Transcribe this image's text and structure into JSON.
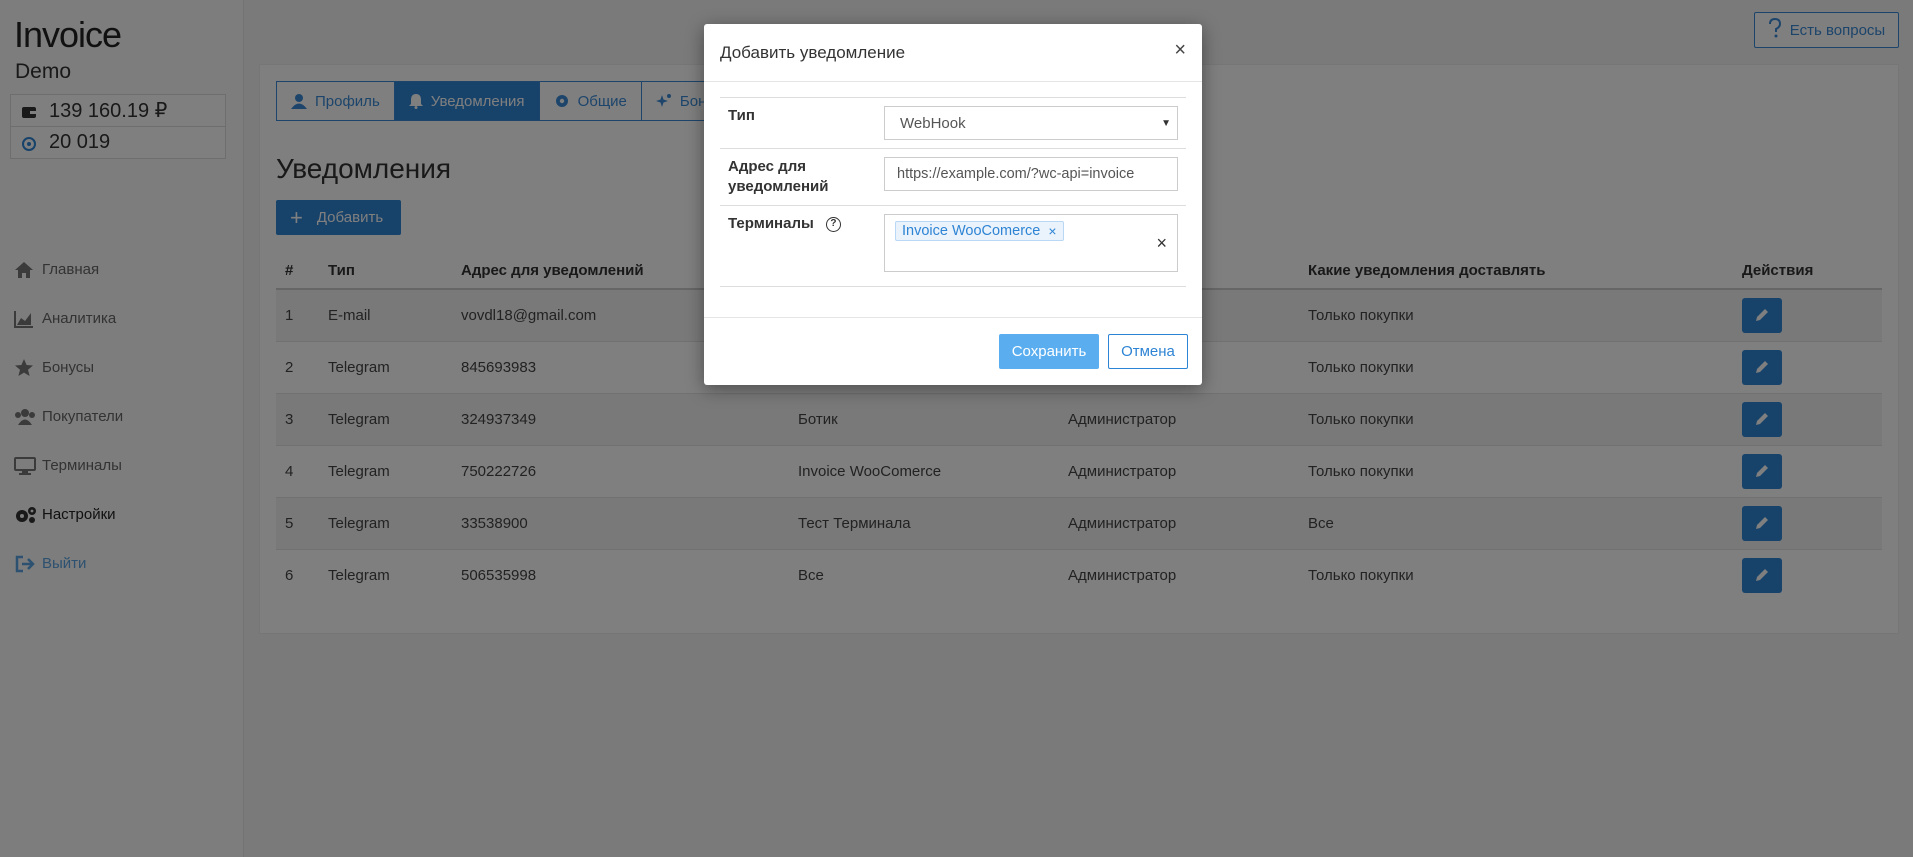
{
  "sidebar": {
    "brand": "Invoice",
    "subbrand": "Demo",
    "balance": "139 160.19 ₽",
    "bonus_balance": "20 019",
    "items": [
      {
        "label": "Главная",
        "icon": "home-icon"
      },
      {
        "label": "Аналитика",
        "icon": "chart-icon"
      },
      {
        "label": "Бонусы",
        "icon": "star-icon"
      },
      {
        "label": "Покупатели",
        "icon": "users-icon"
      },
      {
        "label": "Терминалы",
        "icon": "monitor-icon"
      },
      {
        "label": "Настройки",
        "icon": "gears-icon"
      },
      {
        "label": "Выйти",
        "icon": "logout-icon"
      }
    ]
  },
  "header": {
    "help_label": "Есть вопросы"
  },
  "tabs": [
    {
      "label": "Профиль",
      "icon": "user-icon"
    },
    {
      "label": "Уведомления",
      "icon": "bell-icon"
    },
    {
      "label": "Общие",
      "icon": "gear-icon"
    },
    {
      "label": "Бону",
      "icon": "sparkle-icon"
    }
  ],
  "main": {
    "title": "Уведомления",
    "add_label": "Добавить"
  },
  "table": {
    "headers": [
      "#",
      "Тип",
      "Адрес для уведомлений",
      "",
      "",
      "Какие уведомления доставлять",
      "Действия"
    ],
    "rows": [
      [
        "1",
        "E-mail",
        "vovdl18@gmail.com",
        "",
        "",
        "Только покупки"
      ],
      [
        "2",
        "Telegram",
        "845693983",
        "",
        "",
        "Только покупки"
      ],
      [
        "3",
        "Telegram",
        "324937349",
        "Ботик",
        "Администратор",
        "Только покупки"
      ],
      [
        "4",
        "Telegram",
        "750222726",
        "Invoice WooComerce",
        "Администратор",
        "Только покупки"
      ],
      [
        "5",
        "Telegram",
        "33538900",
        "Тест Терминала",
        "Администратор",
        "Все"
      ],
      [
        "6",
        "Telegram",
        "506535998",
        "Все",
        "Администратор",
        "Только покупки"
      ]
    ]
  },
  "modal": {
    "title": "Добавить уведомление",
    "close": "×",
    "type_label": "Тип",
    "type_value": "WebHook",
    "address_label": "Адрес для уведомлений",
    "address_value": "https://example.com/?wc-api=invoice",
    "terminals_label": "Терминалы",
    "terminal_chip": "Invoice WooComerce",
    "save_label": "Сохранить",
    "cancel_label": "Отмена"
  },
  "colors": {
    "accent": "#2e84d4",
    "save_button": "#5aaef0",
    "overlay": "rgba(0,0,0,0.5)"
  }
}
